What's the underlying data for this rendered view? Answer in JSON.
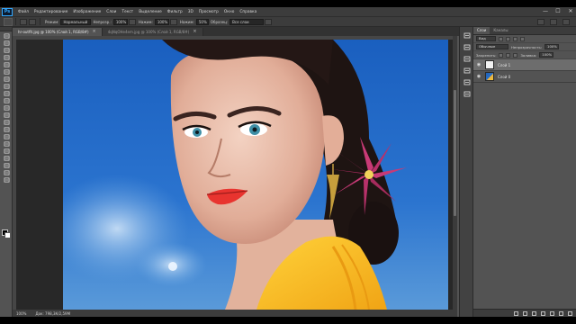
{
  "menubar": {
    "logo": "Ps",
    "items": [
      "Файл",
      "Редактирование",
      "Изображение",
      "Слои",
      "Текст",
      "Выделение",
      "Фильтр",
      "3D",
      "Просмотр",
      "Окно",
      "Справка"
    ],
    "minimize": "—",
    "maximize": "☐",
    "close": "✕"
  },
  "options": {
    "style_label": "Режим:",
    "mode_value": "Нормальный",
    "opacity_label": "Непрозр.:",
    "opacity_value": "100%",
    "pressure_label": "Нажим:",
    "pressure_value": "100%",
    "flow_label": "Нажим:",
    "flow_value": "50%",
    "sample_label": "Образец:",
    "sample_value": "Все слои"
  },
  "tabs": [
    {
      "label": "hr-outfit.jpg @ 100% (Слой 1, RGB/8#)"
    },
    {
      "label": "4qNqOHe4em.jpg @ 100% (Слой 1, RGB/8#)"
    }
  ],
  "status": {
    "zoom": "100%",
    "doc": "Док: 798,3К/2,59М"
  },
  "layers_panel": {
    "tab_layers": "Слои",
    "tab_channels": "Каналы",
    "filter_label": "Вид",
    "blend_mode": "Обычные",
    "opacity_label": "Непрозрачность:",
    "opacity_value": "100%",
    "lock_label": "Закрепить:",
    "fill_label": "Заливка:",
    "fill_value": "100%",
    "layers": [
      {
        "name": "Слой 1",
        "selected": true,
        "thumb": "white"
      },
      {
        "name": "Слой 0",
        "selected": false,
        "thumb": "photo"
      }
    ]
  },
  "colors": {
    "accent": "#31a8ff",
    "ui_dark": "#3c3c3c",
    "ui_mid": "#535353",
    "canvas_bg": "#282828"
  },
  "icons": {
    "toolbar": [
      "move-icon",
      "marquee-icon",
      "lasso-icon",
      "quick-select-icon",
      "crop-icon",
      "eyedropper-icon",
      "healing-icon",
      "brush-icon",
      "clone-stamp-icon",
      "history-brush-icon",
      "eraser-icon",
      "gradient-icon",
      "blur-icon",
      "dodge-icon",
      "pen-icon",
      "type-icon",
      "path-select-icon",
      "shape-icon",
      "hand-icon",
      "zoom-icon",
      "more-icon"
    ],
    "strip": [
      "history-icon",
      "adjustments-icon",
      "swatches-icon",
      "styles-icon",
      "properties-icon",
      "libraries-icon"
    ]
  }
}
